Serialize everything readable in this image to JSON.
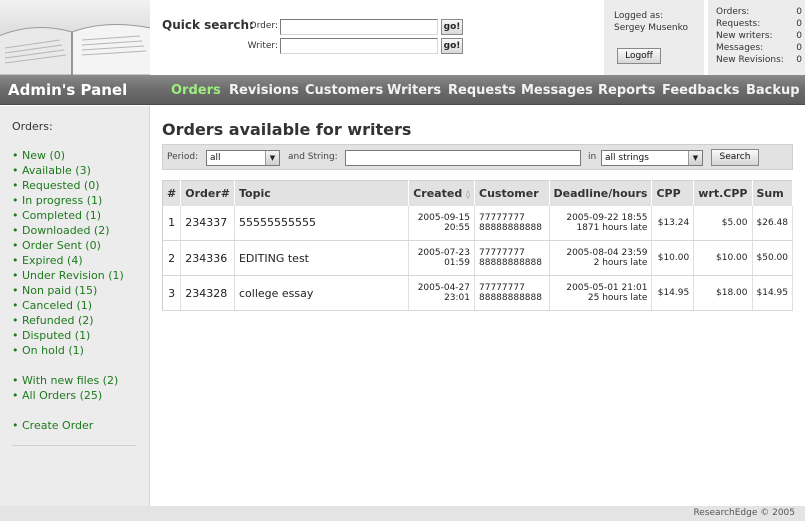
{
  "header": {
    "quick_search": {
      "title": "Quick search:",
      "order_label": "Order:",
      "writer_label": "Writer:",
      "order_value": "",
      "writer_value": "",
      "go_label": "go!"
    },
    "login": {
      "logged_as_label": "Logged as:",
      "user_name": "Sergey Musenko",
      "logoff_label": "Logoff"
    },
    "stats": [
      {
        "label": "Orders:",
        "value": "0"
      },
      {
        "label": "Requests:",
        "value": "0"
      },
      {
        "label": "New writers:",
        "value": "0"
      },
      {
        "label": "Messages:",
        "value": "0"
      },
      {
        "label": "New Revisions:",
        "value": "0"
      }
    ]
  },
  "nav": {
    "brand": "Admin's Panel",
    "items": [
      "Orders",
      "Revisions",
      "Customers",
      "Writers",
      "Requests",
      "Messages",
      "Reports",
      "Feedbacks",
      "Backup"
    ],
    "active": "Orders"
  },
  "sidebar": {
    "title": "Orders:",
    "links": [
      "New (0)",
      "Available (3)",
      "Requested (0)",
      "In progress (1)",
      "Completed (1)",
      "Downloaded (2)",
      "Order Sent (0)",
      "Expired (4)",
      "Under Revision (1)",
      "Non paid (15)",
      "Canceled (1)",
      "Refunded (2)",
      "Disputed (1)",
      "On hold (1)"
    ],
    "extra_links": [
      "With new files (2)",
      "All Orders (25)"
    ],
    "create_link": "Create Order",
    "bullet": "•"
  },
  "main": {
    "title": "Orders available for writers",
    "filter": {
      "period_label": "Period:",
      "period_value": "all",
      "string_label": "and String:",
      "string_value": "",
      "in_label": "in",
      "in_value": "all strings",
      "search_label": "Search"
    },
    "table": {
      "headers": {
        "num": "#",
        "order": "Order#",
        "topic": "Topic",
        "created": "Created",
        "customer": "Customer",
        "deadline": "Deadline/hours",
        "cpp": "CPP",
        "wrt_cpp": "wrt.CPP",
        "sum": "Sum"
      },
      "rows": [
        {
          "num": "1",
          "order": "234337",
          "topic": "55555555555",
          "created_date": "2005-09-15",
          "created_time": "20:55",
          "customer_1": "77777777",
          "customer_2": "88888888888",
          "deadline_date": "2005-09-22 18:55",
          "deadline_hours": "1871 hours late",
          "deadline_late": true,
          "cpp": "$13.24",
          "wrt_cpp": "$5.00",
          "sum": "$26.48"
        },
        {
          "num": "2",
          "order": "234336",
          "topic": "EDITING test",
          "created_date": "2005-07-23",
          "created_time": "01:59",
          "customer_1": "77777777",
          "customer_2": "88888888888",
          "deadline_date": "2005-08-04 23:59",
          "deadline_hours": "2 hours late",
          "deadline_late": false,
          "cpp": "$10.00",
          "wrt_cpp": "$10.00",
          "sum": "$50.00"
        },
        {
          "num": "3",
          "order": "234328",
          "topic": "college essay",
          "created_date": "2005-04-27",
          "created_time": "23:01",
          "customer_1": "77777777",
          "customer_2": "88888888888",
          "deadline_date": "2005-05-01 21:01",
          "deadline_hours": "25 hours late",
          "deadline_late": true,
          "cpp": "$14.95",
          "wrt_cpp": "$18.00",
          "sum": "$14.95"
        }
      ]
    }
  },
  "footer": {
    "text": "ResearchEdge © 2005"
  },
  "colors": {
    "active_nav": "#9cf07e",
    "sidebar_link": "#1d7a1d",
    "late": "#cc0000",
    "navbar": "#6e6e6e"
  }
}
